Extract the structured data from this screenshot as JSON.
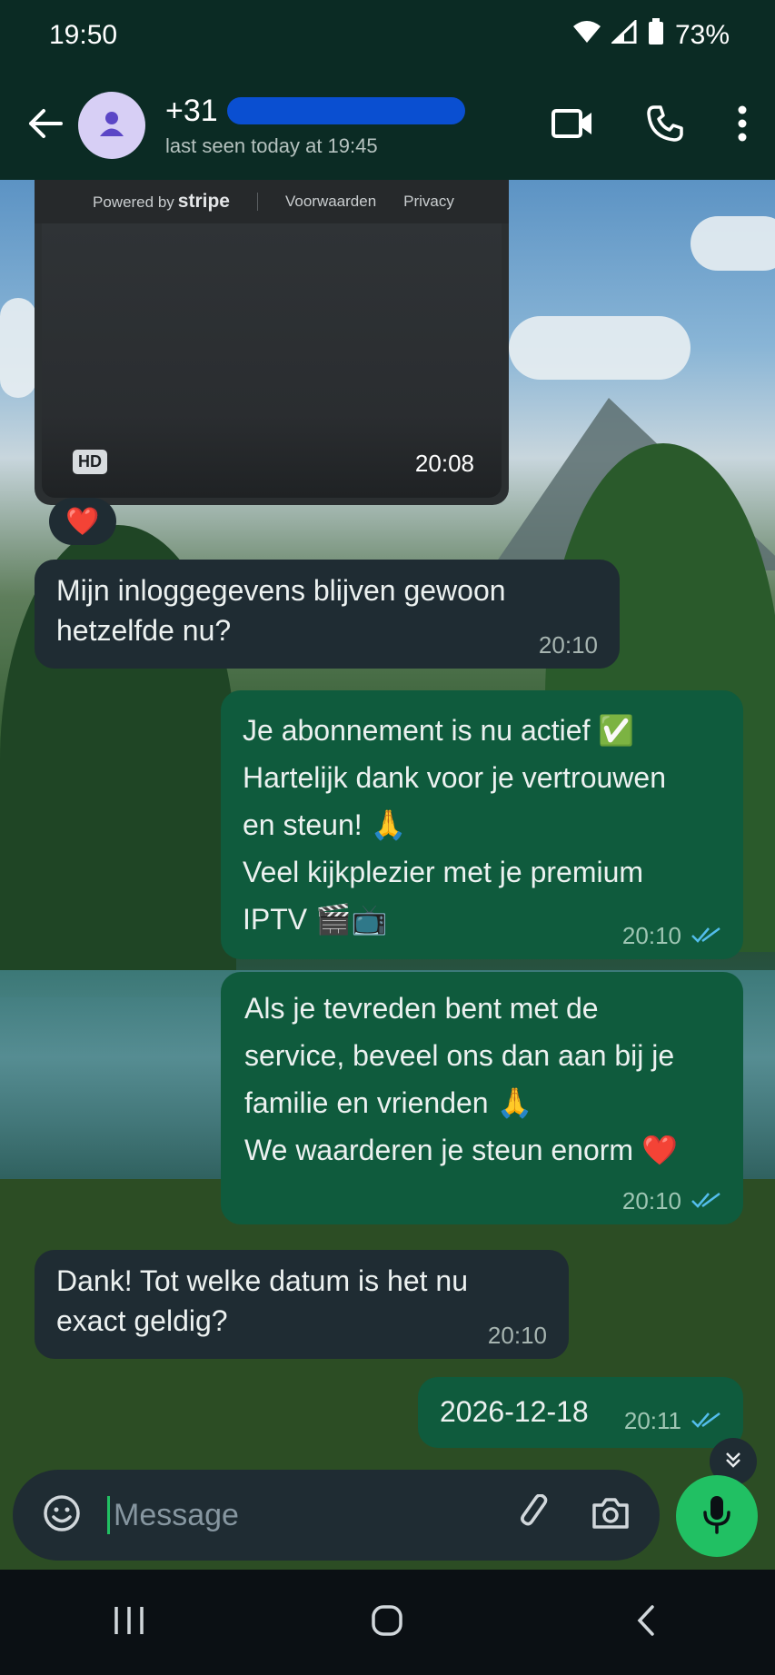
{
  "status_bar": {
    "time": "19:50",
    "battery": "73%",
    "icons": [
      "wifi-icon",
      "signal-icon",
      "battery-icon"
    ]
  },
  "header": {
    "contact_name": "+31",
    "contact_status": "last seen today at 19:45",
    "icons": [
      "back-arrow-icon",
      "avatar-person-icon",
      "video-call-icon",
      "phone-call-icon",
      "more-vertical-icon"
    ]
  },
  "media_message": {
    "powered_by": "Powered by",
    "brand": "stripe",
    "terms": "Voorwaarden",
    "privacy": "Privacy",
    "badge": "HD",
    "time": "20:08",
    "reaction": "❤️"
  },
  "messages": [
    {
      "direction": "in",
      "text": "Mijn inloggegevens blijven gewoon\nhetzelfde nu?",
      "time": "20:10"
    },
    {
      "direction": "out",
      "text": "Je abonnement is nu actief ✅\nHartelijk dank voor je vertrouwen\nen steun! 🙏\nVeel kijkplezier met je premium\nIPTV 🎬📺",
      "time": "20:10",
      "status": "read"
    },
    {
      "direction": "out",
      "text": "Als je tevreden bent met de\nservice, beveel ons dan aan bij je\nfamilie en vrienden 🙏\nWe waarderen je steun enorm ❤️",
      "time": "20:10",
      "status": "read"
    },
    {
      "direction": "in",
      "text": "Dank! Tot welke datum is het nu\nexact geldig?",
      "time": "20:10"
    },
    {
      "direction": "out",
      "text": "2026-12-18",
      "time": "20:11",
      "status": "read"
    }
  ],
  "composer": {
    "placeholder": "Message",
    "icons": [
      "emoji-icon",
      "attach-icon",
      "camera-icon",
      "mic-icon",
      "scroll-down-icon"
    ]
  },
  "nav_bar": {
    "icons": [
      "recents-icon",
      "home-icon",
      "back-icon"
    ]
  },
  "colors": {
    "header_bg": "#0b2b24",
    "incoming_bubble": "#1f2c33",
    "outgoing_bubble": "#0f5b3d",
    "accent": "#21c063",
    "read_ticks": "#53bdeb"
  }
}
